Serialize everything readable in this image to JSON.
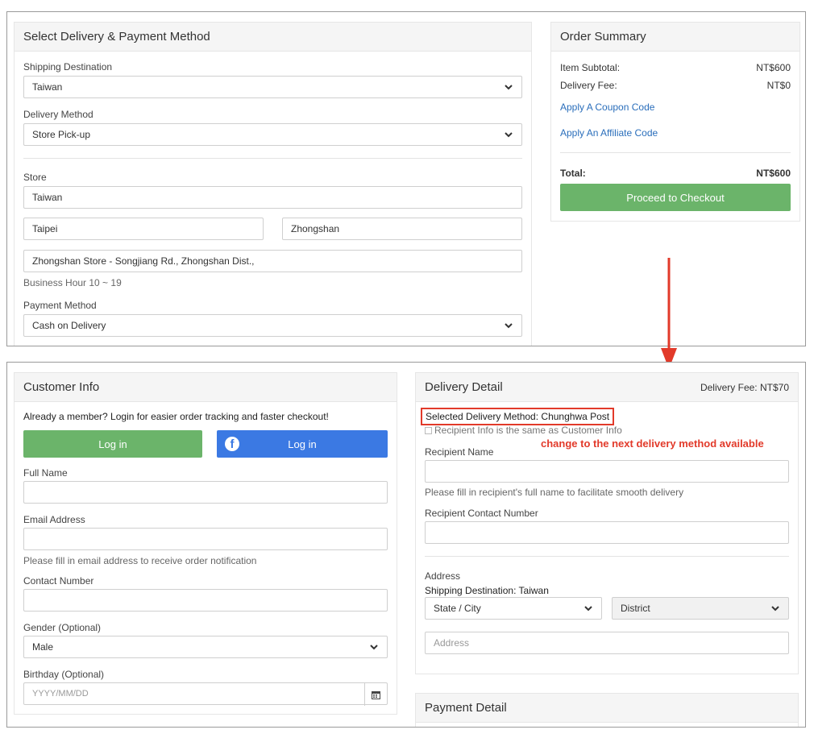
{
  "top": {
    "delivery_panel": {
      "title": "Select Delivery & Payment Method",
      "shipping_destination_label": "Shipping Destination",
      "shipping_destination_value": "Taiwan",
      "delivery_method_label": "Delivery Method",
      "delivery_method_value": "Store Pick-up",
      "store_label": "Store",
      "store_country": "Taiwan",
      "store_city": "Taipei",
      "store_district": "Zhongshan",
      "store_name": "Zhongshan Store - Songjiang Rd., Zhongshan Dist.,",
      "business_hour": "Business Hour 10 ~ 19",
      "payment_method_label": "Payment Method",
      "payment_method_value": "Cash on Delivery"
    },
    "order_summary": {
      "title": "Order Summary",
      "item_subtotal_label": "Item Subtotal:",
      "item_subtotal_value": "NT$600",
      "delivery_fee_label": "Delivery Fee:",
      "delivery_fee_value": "NT$0",
      "coupon_link": "Apply A Coupon Code",
      "affiliate_link": "Apply An Affiliate Code",
      "total_label": "Total:",
      "total_value": "NT$600",
      "checkout_button": "Proceed to Checkout"
    }
  },
  "bottom": {
    "customer_info": {
      "title": "Customer Info",
      "member_prompt": "Already a member? Login for easier order tracking and faster checkout!",
      "login_button": "Log in",
      "facebook_login_button": "Log in",
      "full_name_label": "Full Name",
      "full_name_value": "",
      "email_label": "Email Address",
      "email_value": "",
      "email_hint": "Please fill in email address to receive order notification",
      "contact_label": "Contact Number",
      "contact_value": "",
      "gender_label": "Gender (Optional)",
      "gender_value": "Male",
      "birthday_label": "Birthday (Optional)",
      "birthday_placeholder": "YYYY/MM/DD"
    },
    "delivery_detail": {
      "title": "Delivery Detail",
      "delivery_fee": "Delivery Fee: NT$70",
      "selected_method": "Selected Delivery Method: Chunghwa Post",
      "same_as_customer": "Recipient Info is the same as Customer Info",
      "recipient_name_label": "Recipient Name",
      "recipient_name_value": "",
      "recipient_name_hint": "Please fill in recipient's full name to facilitate smooth delivery",
      "recipient_contact_label": "Recipient Contact Number",
      "recipient_contact_value": "",
      "address_label": "Address",
      "shipping_destination": "Shipping Destination: Taiwan",
      "state_city_value": "State / City",
      "district_value": "District",
      "address_placeholder": "Address"
    },
    "payment_detail": {
      "title": "Payment Detail"
    }
  },
  "annotation": {
    "text": "change to the next delivery method available",
    "color": "#e23a2a"
  },
  "colors": {
    "accent_green": "#6bb46a",
    "facebook_blue": "#3b79e3",
    "link_blue": "#2a6ebb"
  },
  "icons": {
    "select": "chevron-down-icon",
    "facebook": "facebook-icon",
    "calendar": "calendar-icon",
    "arrow": "arrow-down-icon"
  }
}
